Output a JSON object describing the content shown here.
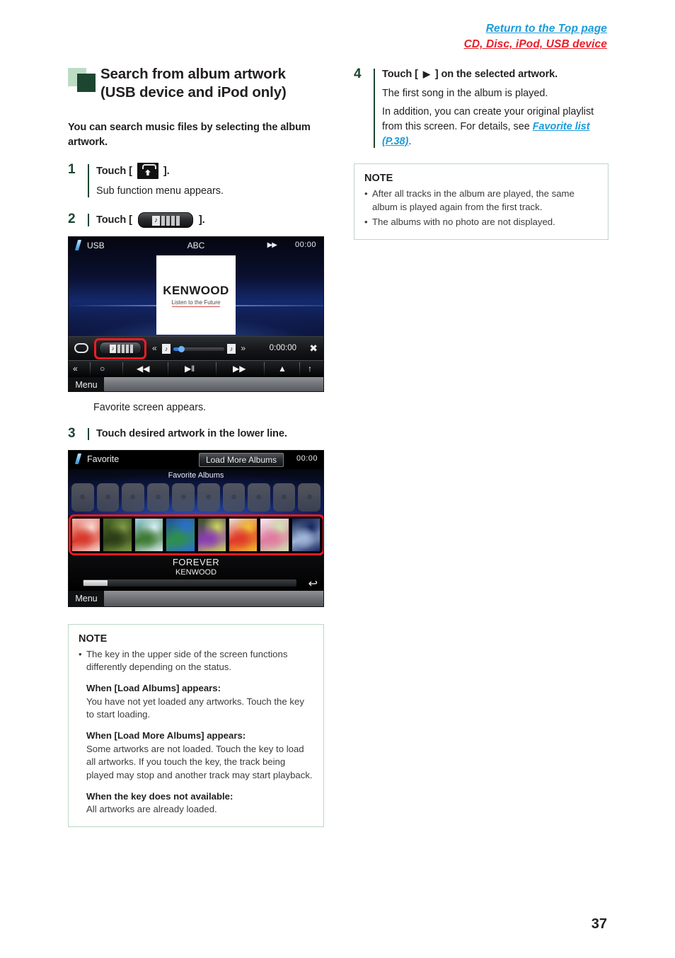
{
  "header": {
    "top_link": "Return to the Top page",
    "sub_link": "CD, Disc, iPod, USB device"
  },
  "section": {
    "title_line1": "Search from album artwork",
    "title_line2": "(USB device and iPod only)",
    "intro": "You can search music files by selecting the album artwork."
  },
  "steps": {
    "step1": {
      "num": "1",
      "head_prefix": "Touch [ ",
      "head_suffix": " ].",
      "icon": "submenu-up-arrow-key",
      "sub": "Sub function menu appears."
    },
    "step2": {
      "num": "2",
      "head_prefix": "Touch [ ",
      "head_suffix": " ].",
      "icon": "album-artwork-key",
      "caption": "Favorite screen appears."
    },
    "step3": {
      "num": "3",
      "head": "Touch desired artwork in the lower line."
    },
    "step4": {
      "num": "4",
      "head_prefix": "Touch [ ",
      "head_glyph": "▶",
      "head_suffix": " ] on the selected artwork.",
      "line1": "The first song in the album is played.",
      "line2": "In addition, you can create your original playlist from this screen. For details, see",
      "link": "Favorite list (P.38)",
      "line2_end": "."
    }
  },
  "device1": {
    "source_label": "USB",
    "title": "ABC",
    "ff_icon": "▶▶",
    "clock": "00:00",
    "artwork_brand": "KENWOOD",
    "artwork_tagline": "Listen to the Future",
    "elapsed_time": "0:00:00",
    "repeat_icon": "repeat-icon",
    "shuffle_icon": "✖",
    "seek_prev_icon": "«",
    "seek_next_icon": "»",
    "note_icon": "♪",
    "bottom_buttons": [
      {
        "icon": "«",
        "name": "back-icon"
      },
      {
        "icon": "○",
        "name": "search-icon"
      },
      {
        "icon": "◀◀",
        "name": "previous-track-icon"
      },
      {
        "icon": "▶‖",
        "name": "play-pause-icon"
      },
      {
        "icon": "▶▶",
        "name": "next-track-icon"
      },
      {
        "icon": "▲",
        "name": "eject-icon"
      },
      {
        "icon": "↑",
        "name": "sub-function-icon"
      }
    ],
    "menu_label": "Menu"
  },
  "device2": {
    "source_label": "Favorite",
    "load_button": "Load More Albums",
    "clock": "00:00",
    "section_label": "Favorite Albums",
    "ghost_count": 10,
    "thumbnails": [
      {
        "name": "album-thumb-red-flowers",
        "c1": "#f2b6a8",
        "c2": "#d8382a",
        "c3": "#f6d9d2"
      },
      {
        "name": "album-thumb-green-bench",
        "c1": "#4b6b24",
        "c2": "#2c3d16",
        "c3": "#7f9a46"
      },
      {
        "name": "album-thumb-landscape",
        "c1": "#9fd3ea",
        "c2": "#3f7a33",
        "c3": "#d8eef6"
      },
      {
        "name": "album-thumb-blue-leaf",
        "c1": "#1f4fa8",
        "c2": "#2f8f4f",
        "c3": "#2b6fd0"
      },
      {
        "name": "album-thumb-purple-orb",
        "c1": "#3a5a1c",
        "c2": "#8a3fb0",
        "c3": "#c9d85a"
      },
      {
        "name": "album-thumb-bouquet",
        "c1": "#e8e4d4",
        "c2": "#e03a28",
        "c3": "#f0c030"
      },
      {
        "name": "album-thumb-pink-blossom",
        "c1": "#f6eef2",
        "c2": "#e07ba0",
        "c3": "#cfe2b0"
      },
      {
        "name": "album-thumb-blue-figure",
        "c1": "#0d1b4a",
        "c2": "#9fb6d8",
        "c3": "#16255e"
      }
    ],
    "song_title": "FOREVER",
    "artist": "KENWOOD",
    "return_icon": "↩",
    "menu_label": "Menu"
  },
  "note_left": {
    "title": "NOTE",
    "bullet": "The key in the upper side of the screen functions differently depending on the status.",
    "subs": [
      {
        "head": "When [Load Albums] appears:",
        "body": "You have not yet loaded any artworks. Touch the key to start loading."
      },
      {
        "head": "When [Load More Albums] appears:",
        "body": "Some artworks are not loaded. Touch the key to load all artworks. If you touch the key, the track being played may stop and another track may start playback."
      },
      {
        "head": "When the key does not available:",
        "body": "All artworks are already loaded."
      }
    ]
  },
  "note_right": {
    "title": "NOTE",
    "bullets": [
      "After all tracks in the album are played, the same album is played again from the first track.",
      "The albums with no photo are not displayed."
    ]
  },
  "page_number": "37",
  "colors": {
    "accent_green": "#1d4631",
    "link_blue": "#1b9bd8",
    "link_red": "#e8202a",
    "highlight_red": "#ee1c25",
    "note_border": "#bcd8c6"
  }
}
